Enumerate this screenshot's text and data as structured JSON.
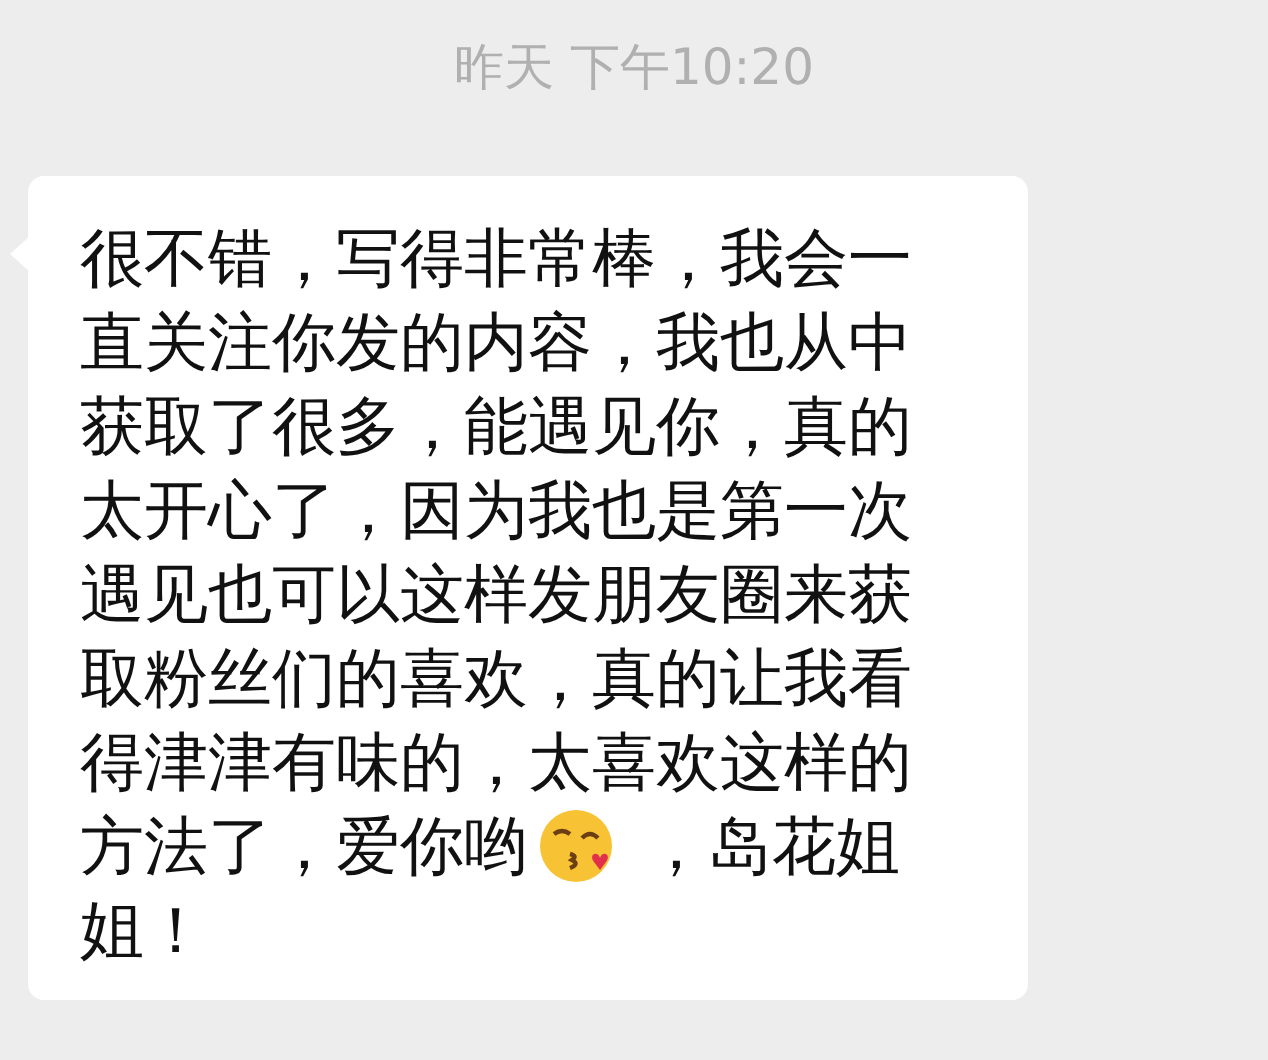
{
  "timestamp": "昨天 下午10:20",
  "message": {
    "lines": [
      {
        "kind": "text",
        "text": "很不错，写得非常棒，我会一"
      },
      {
        "kind": "text",
        "text": "直关注你发的内容，我也从中"
      },
      {
        "kind": "text",
        "text": "获取了很多，能遇见你，真的"
      },
      {
        "kind": "text",
        "text": "太开心了，因为我也是第一次"
      },
      {
        "kind": "text",
        "text": "遇见也可以这样发朋友圈来获"
      },
      {
        "kind": "text",
        "text": "取粉丝们的喜欢，真的让我看"
      },
      {
        "kind": "text",
        "text": "得津津有味的，太喜欢这样的"
      },
      {
        "kind": "emoji",
        "before": "方法了，爱你哟",
        "after": " ，岛花姐"
      },
      {
        "kind": "text",
        "text": "姐！"
      }
    ]
  }
}
